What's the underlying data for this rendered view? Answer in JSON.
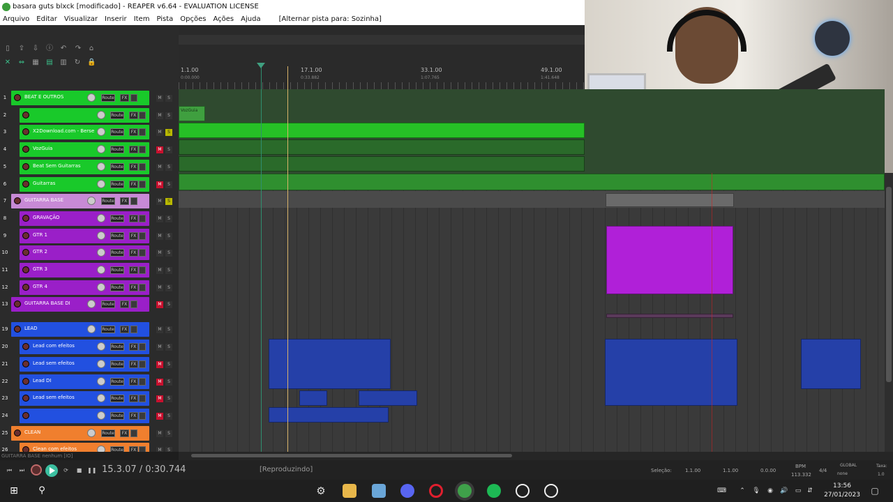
{
  "window": {
    "title": "basara guts blxck [modificado] - REAPER v6.64 - EVALUATION LICENSE"
  },
  "menu": {
    "items": [
      "Arquivo",
      "Editar",
      "Visualizar",
      "Inserir",
      "Item",
      "Pista",
      "Opções",
      "Ações",
      "Ajuda"
    ],
    "action": "[Alternar pista para: Sozinha]"
  },
  "ruler": {
    "marks": [
      {
        "bar": "1.1.00",
        "time": "0:00.000"
      },
      {
        "bar": "17.1.00",
        "time": "0:33.882"
      },
      {
        "bar": "33.1.00",
        "time": "1:07.765"
      },
      {
        "bar": "49.1.00",
        "time": "1:41.648"
      }
    ]
  },
  "route_label": "Route",
  "fx_label": "FX",
  "mute_label": "M",
  "solo_label": "S",
  "tracks": [
    {
      "num": "1",
      "name": "BEAT E OUTROS",
      "folder": true
    },
    {
      "num": "2",
      "name": "",
      "folder": false
    },
    {
      "num": "3",
      "name": "X2Download.com - Berse",
      "folder": false,
      "solo": true
    },
    {
      "num": "4",
      "name": "VozGuia",
      "folder": false,
      "mute": true
    },
    {
      "num": "5",
      "name": "Beat Sem Guitarras",
      "folder": false
    },
    {
      "num": "6",
      "name": "Guitarras",
      "folder": false,
      "mute": true
    },
    {
      "num": "7",
      "name": "GUITARRA BASE",
      "folder": true,
      "solo": true
    },
    {
      "num": "8",
      "name": "GRAVAÇÃO",
      "folder": false
    },
    {
      "num": "9",
      "name": "GTR 1",
      "folder": false
    },
    {
      "num": "10",
      "name": "GTR 2",
      "folder": false
    },
    {
      "num": "11",
      "name": "GTR 3",
      "folder": false
    },
    {
      "num": "12",
      "name": "GTR 4",
      "folder": false
    },
    {
      "num": "13",
      "name": "GUITARRA BASE DI",
      "folder": true,
      "mute": true
    },
    {
      "num": "19",
      "name": "LEAD",
      "folder": true
    },
    {
      "num": "20",
      "name": "Lead com efeitos",
      "folder": false
    },
    {
      "num": "21",
      "name": "Lead sem efeitos",
      "folder": false,
      "mute": true
    },
    {
      "num": "22",
      "name": "Lead DI",
      "folder": false,
      "mute": true
    },
    {
      "num": "23",
      "name": "Lead sem efeitos",
      "folder": false,
      "mute": true
    },
    {
      "num": "24",
      "name": "",
      "folder": false,
      "mute": true
    },
    {
      "num": "25",
      "name": "CLEAN",
      "folder": true
    },
    {
      "num": "26",
      "name": "Clean com efeitos",
      "folder": false
    }
  ],
  "item_labels": {
    "vozguia": "VozGuia"
  },
  "status_line": "GUITARRA BASE nenhum [IO]",
  "transport": {
    "position": "15.3.07 / 0:30.744",
    "state": "[Reproduzindo]",
    "selection_label": "Seleção:",
    "selection_start": "1.1.00",
    "selection_end": "1.1.00",
    "selection_length": "0.0.00",
    "bpm_label": "BPM",
    "bpm": "113.332",
    "time_sig": "4/4",
    "global": "GLOBAL",
    "none": "none",
    "rate_label": "Taxa:",
    "rate": "1.0"
  },
  "taskbar": {
    "time": "13:56",
    "date": "27/01/2023"
  },
  "colors": {
    "green": "#19c92a",
    "pink": "#c88ad6",
    "purple": "#9a1fc8",
    "blue": "#2250e0",
    "orange": "#f07f2e",
    "play": "#3bbfa0"
  }
}
